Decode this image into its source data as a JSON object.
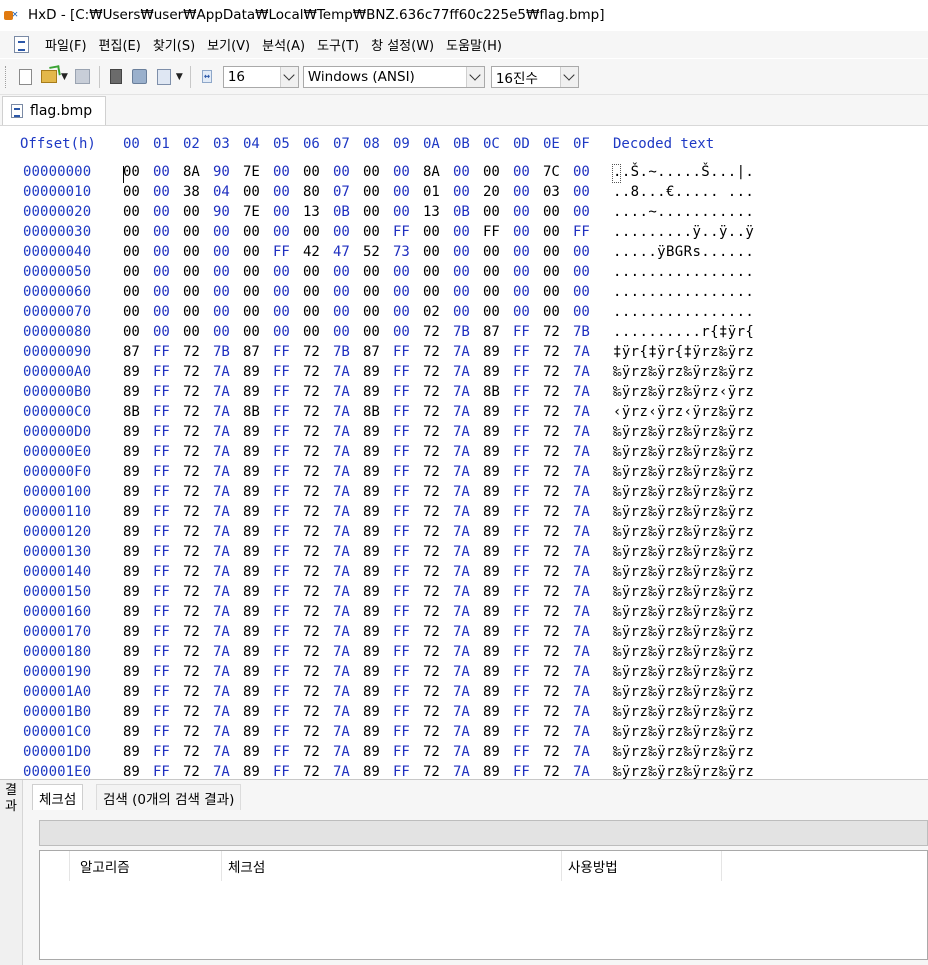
{
  "window": {
    "title": "HxD - [C:₩Users₩user₩AppData₩Local₩Temp₩BNZ.636c77ff60c225e5₩flag.bmp]"
  },
  "menu": {
    "items": [
      "파일(F)",
      "편집(E)",
      "찾기(S)",
      "보기(V)",
      "분석(A)",
      "도구(T)",
      "창 설정(W)",
      "도움말(H)"
    ]
  },
  "toolbar": {
    "icons": [
      "new-file-icon",
      "open-file-icon",
      "save-icon",
      "file-tools-icon",
      "disk-icon",
      "page-icon",
      "bytes-per-row-icon"
    ],
    "bytes_per_row": "16",
    "charset": "Windows (ANSI)",
    "offset_base": "16진수"
  },
  "tabs": {
    "active_file": "flag.bmp"
  },
  "hex": {
    "offset_header": "Offset(h)",
    "decoded_header": "Decoded text",
    "columns": [
      "00",
      "01",
      "02",
      "03",
      "04",
      "05",
      "06",
      "07",
      "08",
      "09",
      "0A",
      "0B",
      "0C",
      "0D",
      "0E",
      "0F"
    ],
    "rows": [
      {
        "offset": "00000000",
        "bytes": "00 00 8A 90 7E 00 00 00 00 00 8A 00 00 00 7C 00",
        "text": "..Š.~.....Š...|."
      },
      {
        "offset": "00000010",
        "bytes": "00 00 38 04 00 00 80 07 00 00 01 00 20 00 03 00",
        "text": "..8...€..... ..."
      },
      {
        "offset": "00000020",
        "bytes": "00 00 00 90 7E 00 13 0B 00 00 13 0B 00 00 00 00",
        "text": "....~..........."
      },
      {
        "offset": "00000030",
        "bytes": "00 00 00 00 00 00 00 00 00 FF 00 00 FF 00 00 FF",
        "text": ".........ÿ..ÿ..ÿ"
      },
      {
        "offset": "00000040",
        "bytes": "00 00 00 00 00 FF 42 47 52 73 00 00 00 00 00 00",
        "text": ".....ÿBGRs......"
      },
      {
        "offset": "00000050",
        "bytes": "00 00 00 00 00 00 00 00 00 00 00 00 00 00 00 00",
        "text": "................"
      },
      {
        "offset": "00000060",
        "bytes": "00 00 00 00 00 00 00 00 00 00 00 00 00 00 00 00",
        "text": "................"
      },
      {
        "offset": "00000070",
        "bytes": "00 00 00 00 00 00 00 00 00 00 02 00 00 00 00 00",
        "text": "................"
      },
      {
        "offset": "00000080",
        "bytes": "00 00 00 00 00 00 00 00 00 00 72 7B 87 FF 72 7B",
        "text": "..........r{‡ÿr{"
      },
      {
        "offset": "00000090",
        "bytes": "87 FF 72 7B 87 FF 72 7B 87 FF 72 7A 89 FF 72 7A",
        "text": "‡ÿr{‡ÿr{‡ÿrz‰ÿrz"
      },
      {
        "offset": "000000A0",
        "bytes": "89 FF 72 7A 89 FF 72 7A 89 FF 72 7A 89 FF 72 7A",
        "text": "‰ÿrz‰ÿrz‰ÿrz‰ÿrz"
      },
      {
        "offset": "000000B0",
        "bytes": "89 FF 72 7A 89 FF 72 7A 89 FF 72 7A 8B FF 72 7A",
        "text": "‰ÿrz‰ÿrz‰ÿrz‹ÿrz"
      },
      {
        "offset": "000000C0",
        "bytes": "8B FF 72 7A 8B FF 72 7A 8B FF 72 7A 89 FF 72 7A",
        "text": "‹ÿrz‹ÿrz‹ÿrz‰ÿrz"
      },
      {
        "offset": "000000D0",
        "bytes": "89 FF 72 7A 89 FF 72 7A 89 FF 72 7A 89 FF 72 7A",
        "text": "‰ÿrz‰ÿrz‰ÿrz‰ÿrz"
      },
      {
        "offset": "000000E0",
        "bytes": "89 FF 72 7A 89 FF 72 7A 89 FF 72 7A 89 FF 72 7A",
        "text": "‰ÿrz‰ÿrz‰ÿrz‰ÿrz"
      },
      {
        "offset": "000000F0",
        "bytes": "89 FF 72 7A 89 FF 72 7A 89 FF 72 7A 89 FF 72 7A",
        "text": "‰ÿrz‰ÿrz‰ÿrz‰ÿrz"
      },
      {
        "offset": "00000100",
        "bytes": "89 FF 72 7A 89 FF 72 7A 89 FF 72 7A 89 FF 72 7A",
        "text": "‰ÿrz‰ÿrz‰ÿrz‰ÿrz"
      },
      {
        "offset": "00000110",
        "bytes": "89 FF 72 7A 89 FF 72 7A 89 FF 72 7A 89 FF 72 7A",
        "text": "‰ÿrz‰ÿrz‰ÿrz‰ÿrz"
      },
      {
        "offset": "00000120",
        "bytes": "89 FF 72 7A 89 FF 72 7A 89 FF 72 7A 89 FF 72 7A",
        "text": "‰ÿrz‰ÿrz‰ÿrz‰ÿrz"
      },
      {
        "offset": "00000130",
        "bytes": "89 FF 72 7A 89 FF 72 7A 89 FF 72 7A 89 FF 72 7A",
        "text": "‰ÿrz‰ÿrz‰ÿrz‰ÿrz"
      },
      {
        "offset": "00000140",
        "bytes": "89 FF 72 7A 89 FF 72 7A 89 FF 72 7A 89 FF 72 7A",
        "text": "‰ÿrz‰ÿrz‰ÿrz‰ÿrz"
      },
      {
        "offset": "00000150",
        "bytes": "89 FF 72 7A 89 FF 72 7A 89 FF 72 7A 89 FF 72 7A",
        "text": "‰ÿrz‰ÿrz‰ÿrz‰ÿrz"
      },
      {
        "offset": "00000160",
        "bytes": "89 FF 72 7A 89 FF 72 7A 89 FF 72 7A 89 FF 72 7A",
        "text": "‰ÿrz‰ÿrz‰ÿrz‰ÿrz"
      },
      {
        "offset": "00000170",
        "bytes": "89 FF 72 7A 89 FF 72 7A 89 FF 72 7A 89 FF 72 7A",
        "text": "‰ÿrz‰ÿrz‰ÿrz‰ÿrz"
      },
      {
        "offset": "00000180",
        "bytes": "89 FF 72 7A 89 FF 72 7A 89 FF 72 7A 89 FF 72 7A",
        "text": "‰ÿrz‰ÿrz‰ÿrz‰ÿrz"
      },
      {
        "offset": "00000190",
        "bytes": "89 FF 72 7A 89 FF 72 7A 89 FF 72 7A 89 FF 72 7A",
        "text": "‰ÿrz‰ÿrz‰ÿrz‰ÿrz"
      },
      {
        "offset": "000001A0",
        "bytes": "89 FF 72 7A 89 FF 72 7A 89 FF 72 7A 89 FF 72 7A",
        "text": "‰ÿrz‰ÿrz‰ÿrz‰ÿrz"
      },
      {
        "offset": "000001B0",
        "bytes": "89 FF 72 7A 89 FF 72 7A 89 FF 72 7A 89 FF 72 7A",
        "text": "‰ÿrz‰ÿrz‰ÿrz‰ÿrz"
      },
      {
        "offset": "000001C0",
        "bytes": "89 FF 72 7A 89 FF 72 7A 89 FF 72 7A 89 FF 72 7A",
        "text": "‰ÿrz‰ÿrz‰ÿrz‰ÿrz"
      },
      {
        "offset": "000001D0",
        "bytes": "89 FF 72 7A 89 FF 72 7A 89 FF 72 7A 89 FF 72 7A",
        "text": "‰ÿrz‰ÿrz‰ÿrz‰ÿrz"
      },
      {
        "offset": "000001E0",
        "bytes": "89 FF 72 7A 89 FF 72 7A 89 FF 72 7A 89 FF 72 7A",
        "text": "‰ÿrz‰ÿrz‰ÿrz‰ÿrz"
      }
    ]
  },
  "results": {
    "side_label": "결과",
    "tabs": [
      "체크섬",
      "검색 (0개의 검색 결과)"
    ],
    "columns": [
      "알고리즘",
      "체크섬",
      "사용방법"
    ]
  },
  "colors": {
    "offset_blue": "#1e39c4",
    "odd_column_blue": "#1f2fc0",
    "panel_gray": "#f6f6f6"
  }
}
